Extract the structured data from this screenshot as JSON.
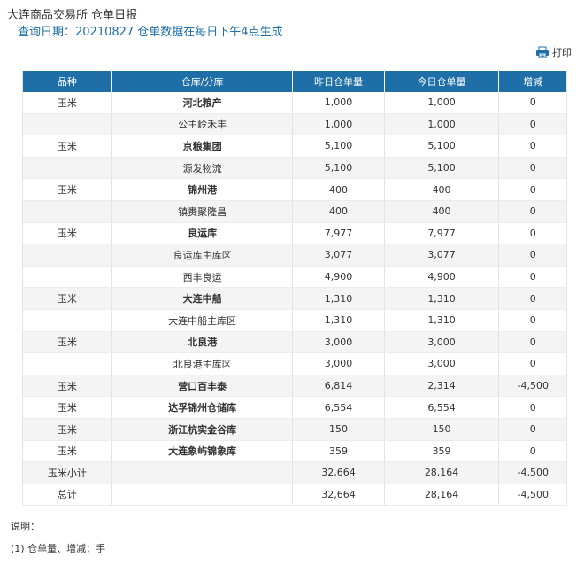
{
  "header": {
    "title": "大连商品交易所 仓单日报",
    "query_line": "查询日期：20210827 仓单数据在每日下午4点生成"
  },
  "toolbar": {
    "print_label": "打印",
    "print_icon": "printer-icon"
  },
  "table": {
    "columns": [
      "品种",
      "仓库/分库",
      "昨日仓单量",
      "今日仓单量",
      "增减"
    ],
    "rows": [
      {
        "variety": "玉米",
        "warehouse": "河北粮产",
        "prev": "1,000",
        "today": "1,000",
        "change": "0",
        "bold": true
      },
      {
        "variety": "",
        "warehouse": "公主岭禾丰",
        "prev": "1,000",
        "today": "1,000",
        "change": "0",
        "bold": false
      },
      {
        "variety": "玉米",
        "warehouse": "京粮集团",
        "prev": "5,100",
        "today": "5,100",
        "change": "0",
        "bold": true
      },
      {
        "variety": "",
        "warehouse": "源发物流",
        "prev": "5,100",
        "today": "5,100",
        "change": "0",
        "bold": false
      },
      {
        "variety": "玉米",
        "warehouse": "锦州港",
        "prev": "400",
        "today": "400",
        "change": "0",
        "bold": true
      },
      {
        "variety": "",
        "warehouse": "镇赉聚隆昌",
        "prev": "400",
        "today": "400",
        "change": "0",
        "bold": false
      },
      {
        "variety": "玉米",
        "warehouse": "良运库",
        "prev": "7,977",
        "today": "7,977",
        "change": "0",
        "bold": true
      },
      {
        "variety": "",
        "warehouse": "良运库主库区",
        "prev": "3,077",
        "today": "3,077",
        "change": "0",
        "bold": false
      },
      {
        "variety": "",
        "warehouse": "西丰良运",
        "prev": "4,900",
        "today": "4,900",
        "change": "0",
        "bold": false
      },
      {
        "variety": "玉米",
        "warehouse": "大连中船",
        "prev": "1,310",
        "today": "1,310",
        "change": "0",
        "bold": true
      },
      {
        "variety": "",
        "warehouse": "大连中船主库区",
        "prev": "1,310",
        "today": "1,310",
        "change": "0",
        "bold": false
      },
      {
        "variety": "玉米",
        "warehouse": "北良港",
        "prev": "3,000",
        "today": "3,000",
        "change": "0",
        "bold": true
      },
      {
        "variety": "",
        "warehouse": "北良港主库区",
        "prev": "3,000",
        "today": "3,000",
        "change": "0",
        "bold": false
      },
      {
        "variety": "玉米",
        "warehouse": "营口百丰泰",
        "prev": "6,814",
        "today": "2,314",
        "change": "-4,500",
        "bold": true
      },
      {
        "variety": "玉米",
        "warehouse": "达孚锦州仓储库",
        "prev": "6,554",
        "today": "6,554",
        "change": "0",
        "bold": true
      },
      {
        "variety": "玉米",
        "warehouse": "浙江杭实金谷库",
        "prev": "150",
        "today": "150",
        "change": "0",
        "bold": true
      },
      {
        "variety": "玉米",
        "warehouse": "大连象屿锦象库",
        "prev": "359",
        "today": "359",
        "change": "0",
        "bold": true
      },
      {
        "variety": "玉米小计",
        "warehouse": "",
        "prev": "32,664",
        "today": "28,164",
        "change": "-4,500",
        "bold": false
      },
      {
        "variety": "总计",
        "warehouse": "",
        "prev": "32,664",
        "today": "28,164",
        "change": "-4,500",
        "bold": false
      }
    ]
  },
  "notes": {
    "title": "说明：",
    "lines": [
      "(1) 仓单量、增减：手"
    ]
  }
}
